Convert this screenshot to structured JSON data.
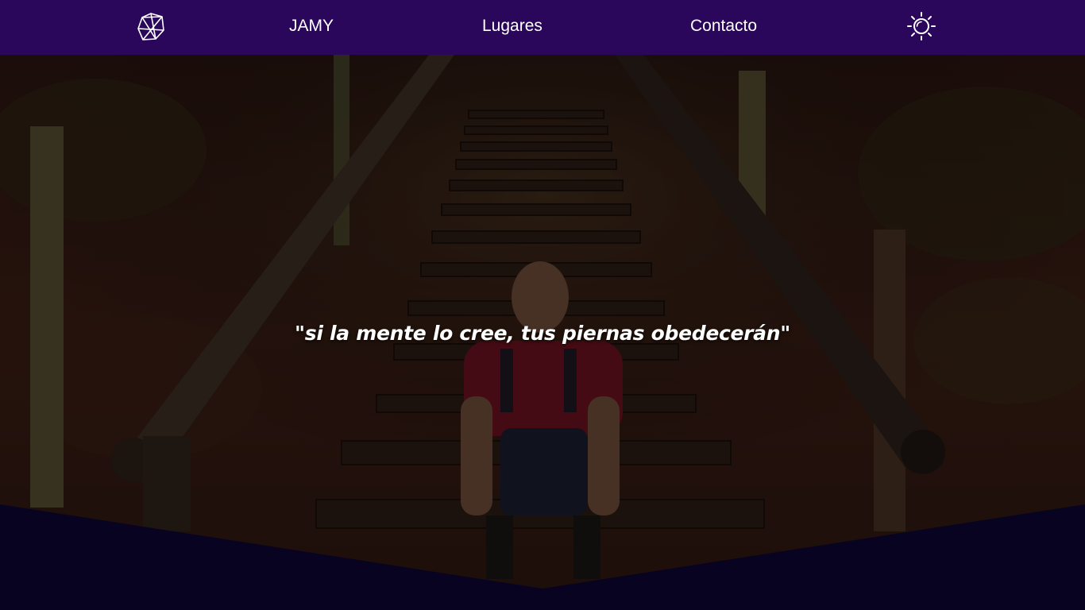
{
  "nav": {
    "logo_icon": "geometric-gem-icon",
    "links": [
      "JAMY",
      "Lugares",
      "Contacto"
    ],
    "theme_icon": "sun-icon"
  },
  "hero": {
    "quote": "\"si la mente lo cree, tus piernas obedecerán\"",
    "background_image": "man-sitting-on-wooden-forest-stairs"
  },
  "colors": {
    "navbar": "#2b075c",
    "bottom_band": "#080320",
    "text": "#ffffff"
  }
}
